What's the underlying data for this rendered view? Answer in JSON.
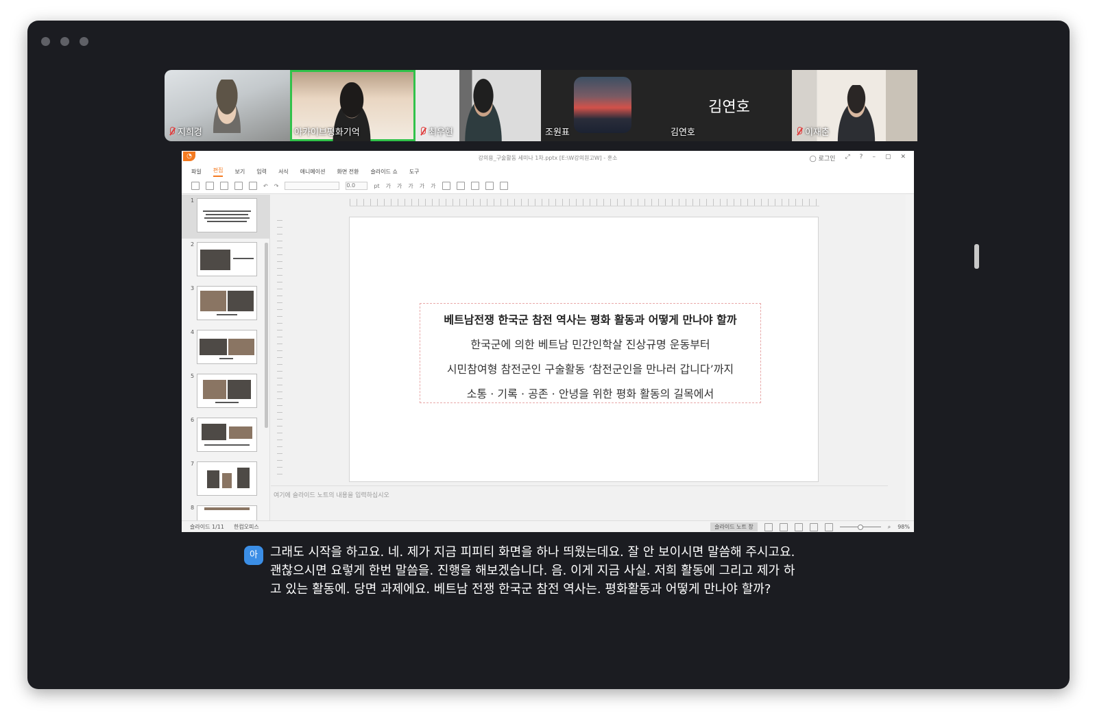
{
  "participants": [
    {
      "name": "지희경",
      "muted": true,
      "active": false
    },
    {
      "name": "아카이브평화기억",
      "muted": false,
      "active": true
    },
    {
      "name": "최우현",
      "muted": true,
      "active": false
    },
    {
      "name": "조원표",
      "muted": false,
      "active": false
    },
    {
      "name": "김연호",
      "muted": false,
      "active": false,
      "big_name": "김연호"
    },
    {
      "name": "이재춘",
      "muted": true,
      "active": false
    }
  ],
  "presentation": {
    "window_title": "강의용_구술활동 세미나 1차.pptx [E:\\W강의원고W] - 훈소",
    "login_label": "로그인",
    "menus": [
      "파일",
      "편집",
      "보기",
      "입력",
      "서식",
      "애니메이션",
      "화면 전환",
      "슬라이드 쇼",
      "도구"
    ],
    "active_menu_index": 1,
    "font_size": "0.0",
    "font_unit": "pt",
    "slide_count": 8,
    "slide": {
      "title": "베트남전쟁 한국군 참전 역사는 평화 활동과 어떻게 만나야 할까",
      "line1": "한국군에 의한 베트남 민간인학살 진상규명 운동부터",
      "line2": "시민참여형 참전군인 구술활동 ‘참전군인을 만나러 갑니다’까지",
      "line3": "소통 · 기록 · 공존 · 안녕을 위한 평화 활동의 길목에서"
    },
    "notes_placeholder": "여기에 슬라이드 노트의 내용을 입력하십시오",
    "status": {
      "slide_indicator": "슬라이드 1/11",
      "app_name": "한컴오피스",
      "notes_button": "슬라이드 노트 창",
      "zoom": "98%"
    }
  },
  "caption": {
    "speaker_initial": "아",
    "text": "그래도 시작을 하고요. 네. 제가 지금 피피티 화면을 하나 띄웠는데요. 잘 안 보이시면 말씀해 주시고요. 괜찮으시면 요렇게 한번 말씀을. 진행을 해보겠습니다. 음. 이게 지금 사실. 저희 활동에 그리고 제가 하고 있는 활동에. 당면 과제에요. 베트남 전쟁 한국군 참전 역사는. 평화활동과 어떻게 만나야 할까?"
  },
  "icons": [
    "mic-muted-icon",
    "login-icon",
    "expand-icon",
    "help-icon",
    "minimize-icon",
    "maximize-icon",
    "close-icon",
    "zoom-icon"
  ]
}
